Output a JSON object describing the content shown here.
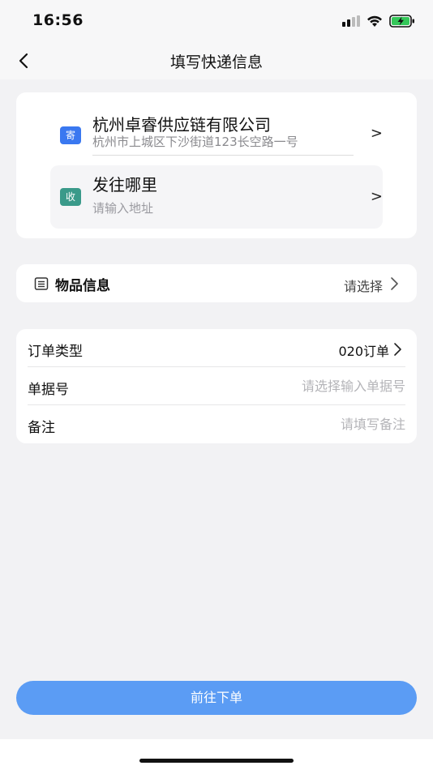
{
  "status_bar": {
    "time": "16:56",
    "icons": [
      "signal-icon",
      "wifi-icon",
      "battery-charging-icon"
    ],
    "battery_color": "#34c759"
  },
  "nav": {
    "title": "填写快递信息",
    "back_icon": "chevron-left-icon"
  },
  "sender": {
    "tag": "寄",
    "name": "杭州卓睿供应链有限公司",
    "address": "杭州市上城区下沙街道123长空路一号",
    "arrow": ">",
    "tag_color": "#3a78f0"
  },
  "receiver": {
    "tag": "收",
    "name": "发往哪里",
    "address_placeholder": "请输入地址",
    "arrow": ">",
    "tag_color": "#3a9a8a"
  },
  "goods": {
    "icon": "list-icon",
    "label": "物品信息",
    "value": "请选择"
  },
  "form": {
    "order_type": {
      "label": "订单类型",
      "value": "020订单"
    },
    "doc_no": {
      "label": "单据号",
      "placeholder": "请选择输入单据号",
      "value": ""
    },
    "remark": {
      "label": "备注",
      "placeholder": "请填写备注",
      "value": ""
    }
  },
  "submit": {
    "label": "前往下单",
    "color": "#5b9cf4"
  }
}
